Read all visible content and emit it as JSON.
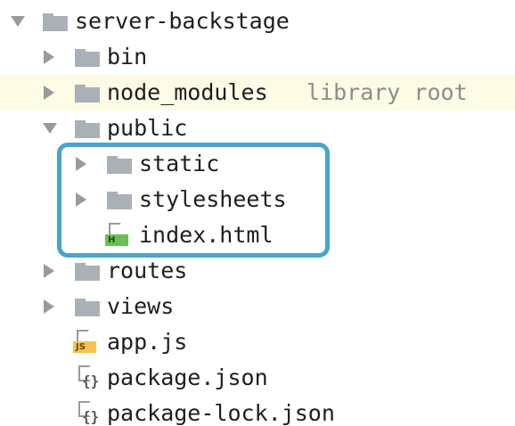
{
  "tree": {
    "root": {
      "label": "server-backstage",
      "expanded": true
    },
    "bin": {
      "label": "bin"
    },
    "node_modules": {
      "label": "node_modules",
      "hint": "library root"
    },
    "public": {
      "label": "public",
      "expanded": true
    },
    "static": {
      "label": "static"
    },
    "stylesheets": {
      "label": "stylesheets"
    },
    "index_html": {
      "label": "index.html",
      "badge": "H"
    },
    "routes": {
      "label": "routes"
    },
    "views": {
      "label": "views"
    },
    "app_js": {
      "label": "app.js",
      "badge": "JS"
    },
    "package_json": {
      "label": "package.json"
    },
    "package_lock_json": {
      "label": "package-lock.json"
    }
  },
  "colors": {
    "highlight_row": "#fdfbe5",
    "selection_border": "#4aa3cc",
    "folder": "#aab0b6",
    "html_badge": "#6cbd55",
    "js_badge": "#f5c354"
  }
}
